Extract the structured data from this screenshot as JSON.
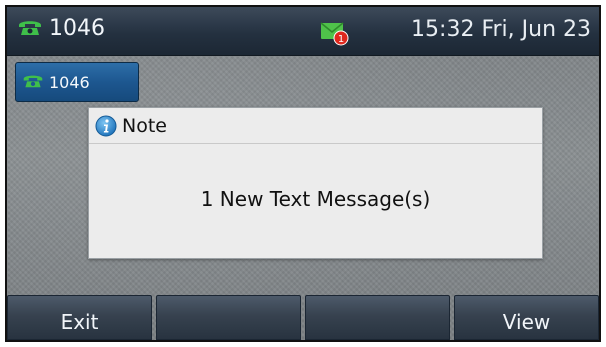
{
  "status_bar": {
    "line_label": "1046",
    "icon": "phone-icon",
    "message_icon": "new-message-icon",
    "message_badge": "1",
    "datetime": "15:32 Fri, Jun 23"
  },
  "line_key": {
    "label": "1046",
    "icon": "phone-icon"
  },
  "dialog": {
    "icon": "info-icon",
    "title": "Note",
    "message": "1 New Text Message(s)"
  },
  "softkeys": [
    {
      "label": "Exit"
    },
    {
      "label": ""
    },
    {
      "label": ""
    },
    {
      "label": "View"
    }
  ],
  "colors": {
    "status_bar": "#243140",
    "line_key": "#1d5790",
    "softkey": "#37424f",
    "phone_icon": "#3fbf4a",
    "badge": "#e0281e"
  }
}
